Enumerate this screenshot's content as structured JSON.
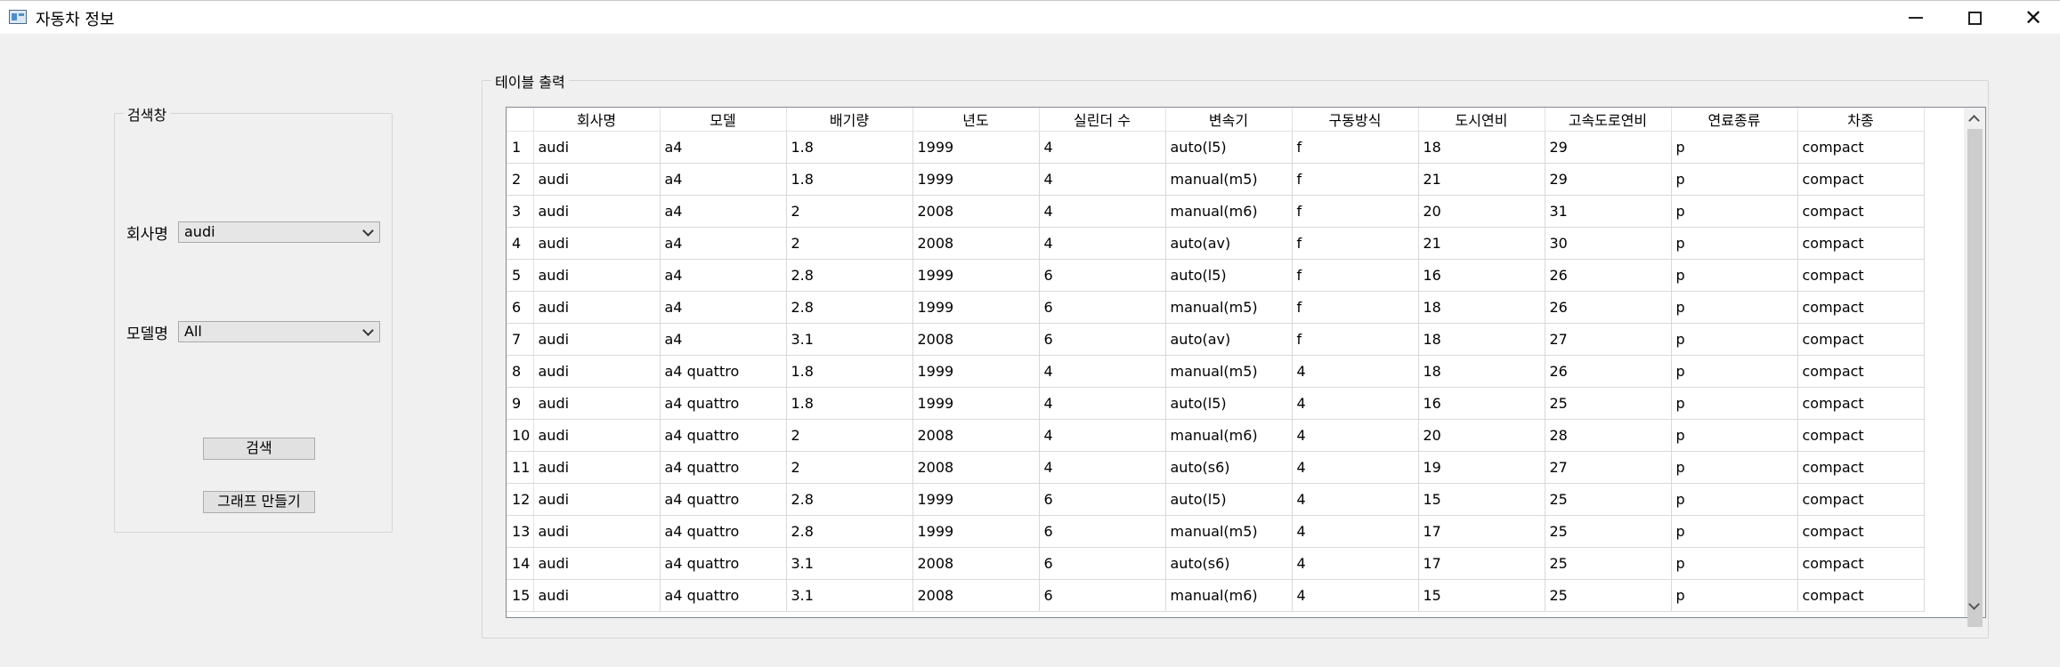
{
  "window": {
    "title": "자동차 정보"
  },
  "search": {
    "group_title": "검색창",
    "company_label": "회사명",
    "company_value": "audi",
    "model_label": "모델명",
    "model_value": "All",
    "search_button": "검색",
    "graph_button": "그래프 만들기"
  },
  "table": {
    "group_title": "테이블 출력",
    "columns": [
      "회사명",
      "모델",
      "배기량",
      "년도",
      "실린더 수",
      "변속기",
      "구동방식",
      "도시연비",
      "고속도로연비",
      "연료종류",
      "차종"
    ],
    "rows": [
      [
        "1",
        "audi",
        "a4",
        "1.8",
        "1999",
        "4",
        "auto(l5)",
        "f",
        "18",
        "29",
        "p",
        "compact"
      ],
      [
        "2",
        "audi",
        "a4",
        "1.8",
        "1999",
        "4",
        "manual(m5)",
        "f",
        "21",
        "29",
        "p",
        "compact"
      ],
      [
        "3",
        "audi",
        "a4",
        "2",
        "2008",
        "4",
        "manual(m6)",
        "f",
        "20",
        "31",
        "p",
        "compact"
      ],
      [
        "4",
        "audi",
        "a4",
        "2",
        "2008",
        "4",
        "auto(av)",
        "f",
        "21",
        "30",
        "p",
        "compact"
      ],
      [
        "5",
        "audi",
        "a4",
        "2.8",
        "1999",
        "6",
        "auto(l5)",
        "f",
        "16",
        "26",
        "p",
        "compact"
      ],
      [
        "6",
        "audi",
        "a4",
        "2.8",
        "1999",
        "6",
        "manual(m5)",
        "f",
        "18",
        "26",
        "p",
        "compact"
      ],
      [
        "7",
        "audi",
        "a4",
        "3.1",
        "2008",
        "6",
        "auto(av)",
        "f",
        "18",
        "27",
        "p",
        "compact"
      ],
      [
        "8",
        "audi",
        "a4 quattro",
        "1.8",
        "1999",
        "4",
        "manual(m5)",
        "4",
        "18",
        "26",
        "p",
        "compact"
      ],
      [
        "9",
        "audi",
        "a4 quattro",
        "1.8",
        "1999",
        "4",
        "auto(l5)",
        "4",
        "16",
        "25",
        "p",
        "compact"
      ],
      [
        "10",
        "audi",
        "a4 quattro",
        "2",
        "2008",
        "4",
        "manual(m6)",
        "4",
        "20",
        "28",
        "p",
        "compact"
      ],
      [
        "11",
        "audi",
        "a4 quattro",
        "2",
        "2008",
        "4",
        "auto(s6)",
        "4",
        "19",
        "27",
        "p",
        "compact"
      ],
      [
        "12",
        "audi",
        "a4 quattro",
        "2.8",
        "1999",
        "6",
        "auto(l5)",
        "4",
        "15",
        "25",
        "p",
        "compact"
      ],
      [
        "13",
        "audi",
        "a4 quattro",
        "2.8",
        "1999",
        "6",
        "manual(m5)",
        "4",
        "17",
        "25",
        "p",
        "compact"
      ],
      [
        "14",
        "audi",
        "a4 quattro",
        "3.1",
        "2008",
        "6",
        "auto(s6)",
        "4",
        "17",
        "25",
        "p",
        "compact"
      ],
      [
        "15",
        "audi",
        "a4 quattro",
        "3.1",
        "2008",
        "6",
        "manual(m6)",
        "4",
        "15",
        "25",
        "p",
        "compact"
      ]
    ]
  }
}
